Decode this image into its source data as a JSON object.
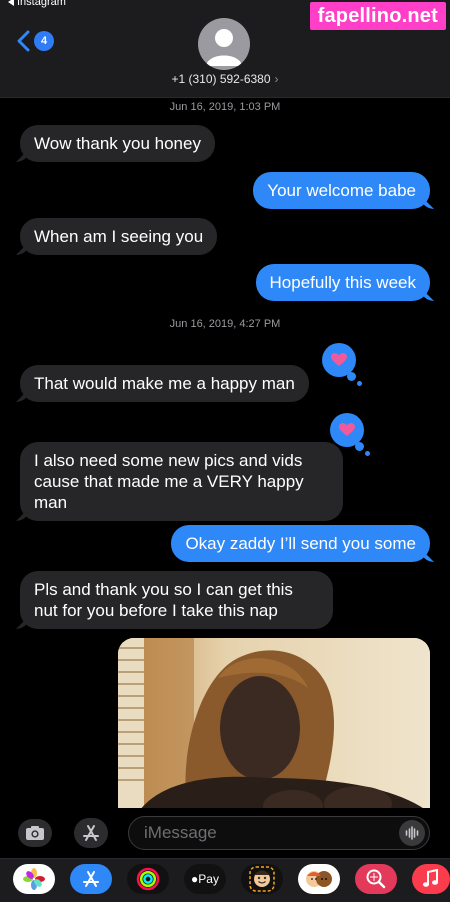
{
  "status": {
    "back_app": "Instagram"
  },
  "header": {
    "unread_count": "4",
    "contact": "+1 (310) 592-6380"
  },
  "watermark": "fapellino.net",
  "thread": [
    {
      "type": "timestamp",
      "text": "Jun 16, 2019, 1:03 PM"
    },
    {
      "type": "in",
      "text": "Wow thank you honey"
    },
    {
      "type": "out",
      "text": "Your welcome babe"
    },
    {
      "type": "in",
      "text": "When am I seeing you"
    },
    {
      "type": "out",
      "text": "Hopefully this week"
    },
    {
      "type": "timestamp",
      "text": "Jun 16, 2019, 4:27 PM"
    },
    {
      "type": "in",
      "text": "That would make me a happy man",
      "tapback": "heart"
    },
    {
      "type": "in",
      "text": "I also need some new pics and vids cause that made me a VERY happy man",
      "tapback": "heart"
    },
    {
      "type": "out",
      "text": "Okay zaddy I’ll send you some"
    },
    {
      "type": "in",
      "text": "Pls and thank you so I can get this nut for you before I take this nap"
    },
    {
      "type": "out-photo"
    }
  ],
  "composer": {
    "placeholder": "iMessage",
    "value": ""
  },
  "app_drawer": [
    {
      "icon": "photos-icon"
    },
    {
      "icon": "app-store-icon"
    },
    {
      "icon": "activity-icon"
    },
    {
      "icon": "apple-pay-icon",
      "label": "Pay"
    },
    {
      "icon": "memoji-icon"
    },
    {
      "icon": "memoji-stickers-icon"
    },
    {
      "icon": "web-search-icon"
    },
    {
      "icon": "music-icon"
    }
  ],
  "colors": {
    "blue": "#2f88f8",
    "gray_bubble": "#262628",
    "watermark": "#ff3fc8"
  }
}
